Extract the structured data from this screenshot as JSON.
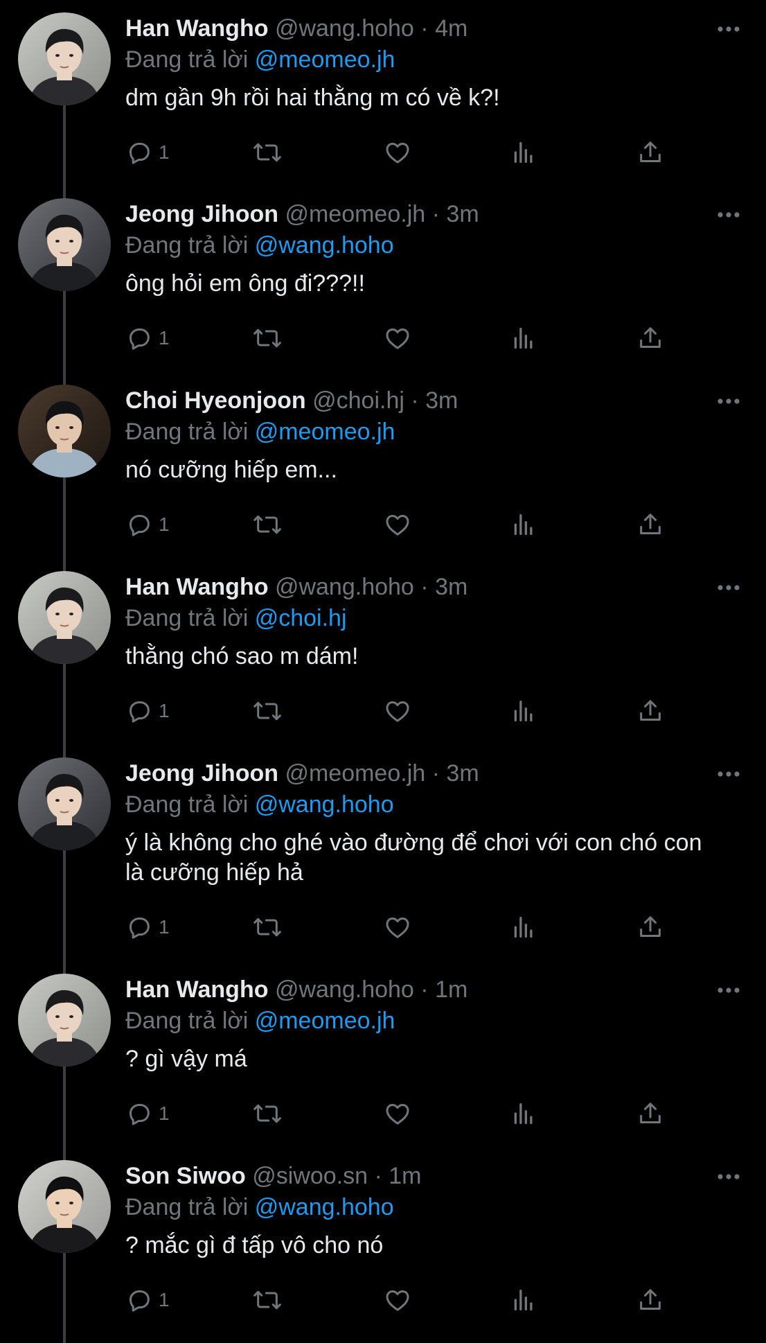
{
  "colors": {
    "background": "#000000",
    "primary_text": "#e7e9ea",
    "secondary_text": "#71767b",
    "accent": "#1d9bf0",
    "thread_line": "#3a3d42"
  },
  "reply_prefix": "Đang trả lời",
  "tweets": [
    {
      "name": "Han Wangho",
      "handle": "@wang.hoho",
      "dot": "·",
      "time": "4m",
      "reply_to": "@meomeo.jh",
      "text": "dm gần 9h rồi hai thằng m có về k?!",
      "reply_count": "1",
      "avatar_icon": "han-wangho-avatar"
    },
    {
      "name": "Jeong Jihoon",
      "handle": "@meomeo.jh",
      "dot": "·",
      "time": "3m",
      "reply_to": "@wang.hoho",
      "text": "ông hỏi em ông đi???!!",
      "reply_count": "1",
      "avatar_icon": "jeong-jihoon-avatar"
    },
    {
      "name": "Choi Hyeonjoon",
      "handle": "@choi.hj",
      "dot": "·",
      "time": "3m",
      "reply_to": "@meomeo.jh",
      "text": "nó cưỡng hiếp em...",
      "reply_count": "1",
      "avatar_icon": "choi-hyeonjoon-avatar"
    },
    {
      "name": "Han Wangho",
      "handle": "@wang.hoho",
      "dot": "·",
      "time": "3m",
      "reply_to": "@choi.hj",
      "text": "thằng chó sao m dám!",
      "reply_count": "1",
      "avatar_icon": "han-wangho-avatar"
    },
    {
      "name": "Jeong Jihoon",
      "handle": "@meomeo.jh",
      "dot": "·",
      "time": "3m",
      "reply_to": "@wang.hoho",
      "text": "ý là không cho ghé vào đường để chơi với con chó con là cưỡng hiếp hả",
      "reply_count": "1",
      "avatar_icon": "jeong-jihoon-avatar"
    },
    {
      "name": "Han Wangho",
      "handle": "@wang.hoho",
      "dot": "·",
      "time": "1m",
      "reply_to": "@meomeo.jh",
      "text": "? gì vậy má",
      "reply_count": "1",
      "avatar_icon": "han-wangho-avatar"
    },
    {
      "name": "Son Siwoo",
      "handle": "@siwoo.sn",
      "dot": "·",
      "time": "1m",
      "reply_to": "@wang.hoho",
      "text": "? mắc gì đ tấp vô cho nó",
      "reply_count": "1",
      "avatar_icon": "son-siwoo-avatar"
    }
  ]
}
